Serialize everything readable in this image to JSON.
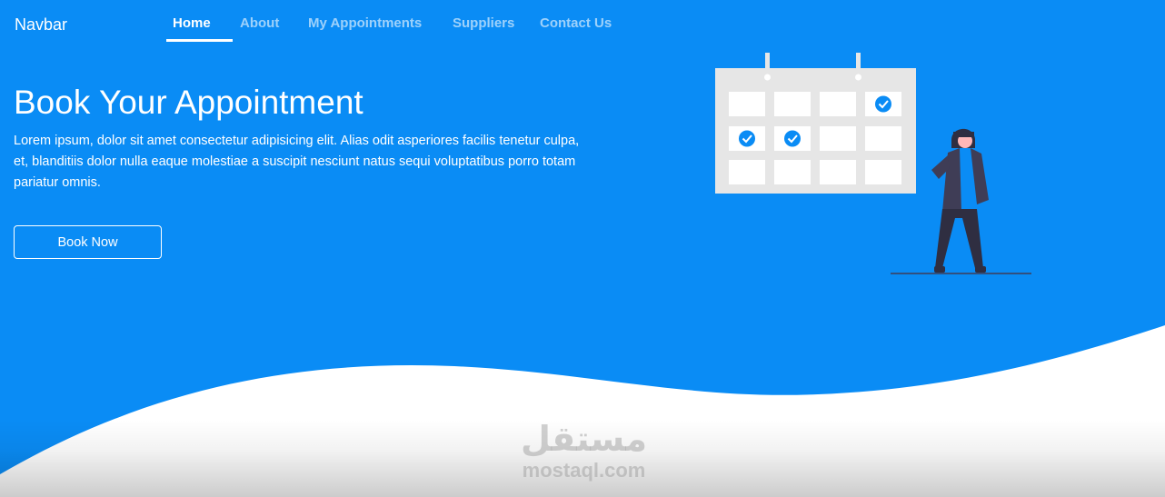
{
  "navbar": {
    "brand": "Navbar",
    "links": [
      {
        "label": "Home",
        "active": true
      },
      {
        "label": "About",
        "active": false
      },
      {
        "label": "My Appointments",
        "active": false
      },
      {
        "label": "Suppliers",
        "active": false
      },
      {
        "label": "Contact Us",
        "active": false
      }
    ]
  },
  "hero": {
    "title": "Book Your Appointment",
    "description": "Lorem ipsum, dolor sit amet consectetur adipisicing elit. Alias odit asperiores facilis tenetur culpa, et, blanditiis dolor nulla eaque molestiae a suscipit nesciunt natus sequi voluptatibus porro totam pariatur omnis.",
    "button_label": "Book Now"
  },
  "illustration": {
    "checked_slots": [
      "row1-col4",
      "row2-col1",
      "row2-col2"
    ]
  },
  "watermark": {
    "arabic": "مستقل",
    "latin": "mostaql.com"
  },
  "colors": {
    "primary": "#0a8cf5",
    "white": "#ffffff",
    "calendar_panel": "#e6e6e6",
    "figure_dark": "#2f2e41",
    "jacket": "#3f3d56"
  }
}
